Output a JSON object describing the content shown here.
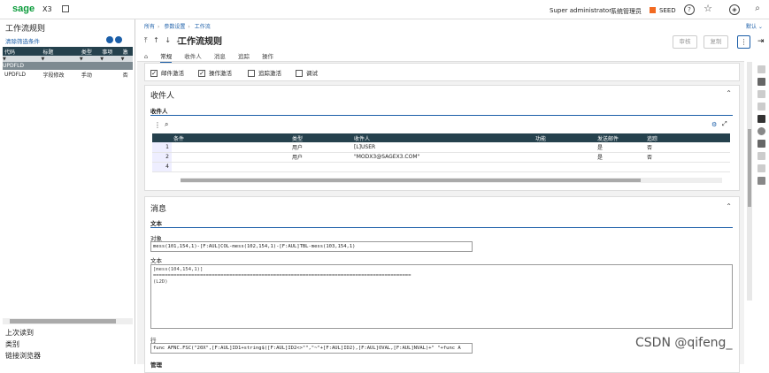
{
  "topbar": {
    "logo": "sage",
    "app": "X3",
    "user": "Super administrator",
    "role": "系统管理员",
    "folder": "SEED",
    "icons": [
      "help-icon",
      "star-icon",
      "compass-icon",
      "search-icon"
    ]
  },
  "left": {
    "title": "工作流规则",
    "filter_label": "清除筛选条件",
    "columns": [
      "代码",
      "标题",
      "类型",
      "事项",
      "激"
    ],
    "selected": "UPDFLD",
    "rows": [
      {
        "code": "UPDFLD",
        "title": "字段修改",
        "type": "手动",
        "event": "",
        "x": "否"
      }
    ],
    "footer": [
      "上次读到",
      "类别",
      "链接浏览器"
    ]
  },
  "header": {
    "crumbs": [
      "所有",
      "参数设置",
      "工作流"
    ],
    "arrows": "⤒ ↑ ↓ ⤓",
    "title": "工作流规则",
    "tabs": [
      "常规",
      "收件人",
      "消息",
      "追踪",
      "操作"
    ],
    "btn_audit": "审核",
    "btn_copy": "复制",
    "default": "默认 ⌄"
  },
  "checkboxes": [
    {
      "label": "邮件激活",
      "checked": true
    },
    {
      "label": "操作激活",
      "checked": true
    },
    {
      "label": "追踪激活",
      "checked": false
    },
    {
      "label": "调试",
      "checked": false
    }
  ],
  "recipients": {
    "section": "收件人",
    "sub": "收件人",
    "columns": [
      "",
      "条件",
      "类型",
      "收件人",
      "功能",
      "发送邮件",
      "追踪",
      ""
    ],
    "rows": [
      {
        "n": "1",
        "cond": "",
        "type": "用户",
        "rec": "[L]USER",
        "func": "",
        "send": "是",
        "track": "否"
      },
      {
        "n": "2",
        "cond": "",
        "type": "用户",
        "rec": "\"MODX3@SAGEX3.COM\"",
        "func": "",
        "send": "是",
        "track": "否"
      },
      {
        "n": "4",
        "cond": "",
        "type": "",
        "rec": "",
        "func": "",
        "send": "",
        "track": ""
      }
    ]
  },
  "message": {
    "section": "消息",
    "sub": "文本",
    "subject_label": "对象",
    "subject": "mess(101,154,1)-[F:AUL]COL-mess(102,154,1)-[F:AUL]TBL-mess(103,154,1)",
    "text_label": "文本",
    "text": "[mess(104,154,1)]\n========================================================================================\n(L2D)",
    "line_label": "行",
    "line": "func AFNC.FSC(\"20X\",[F:AUL]ID1+string$([F:AUL]ID2<>\"\",\"~\"+[F:AUL]ID2),[F:AUL]OVAL,[F:AUL]NVAL)+\" \"+func A",
    "more_label": "管理"
  },
  "watermark": "CSDN @qifeng_"
}
